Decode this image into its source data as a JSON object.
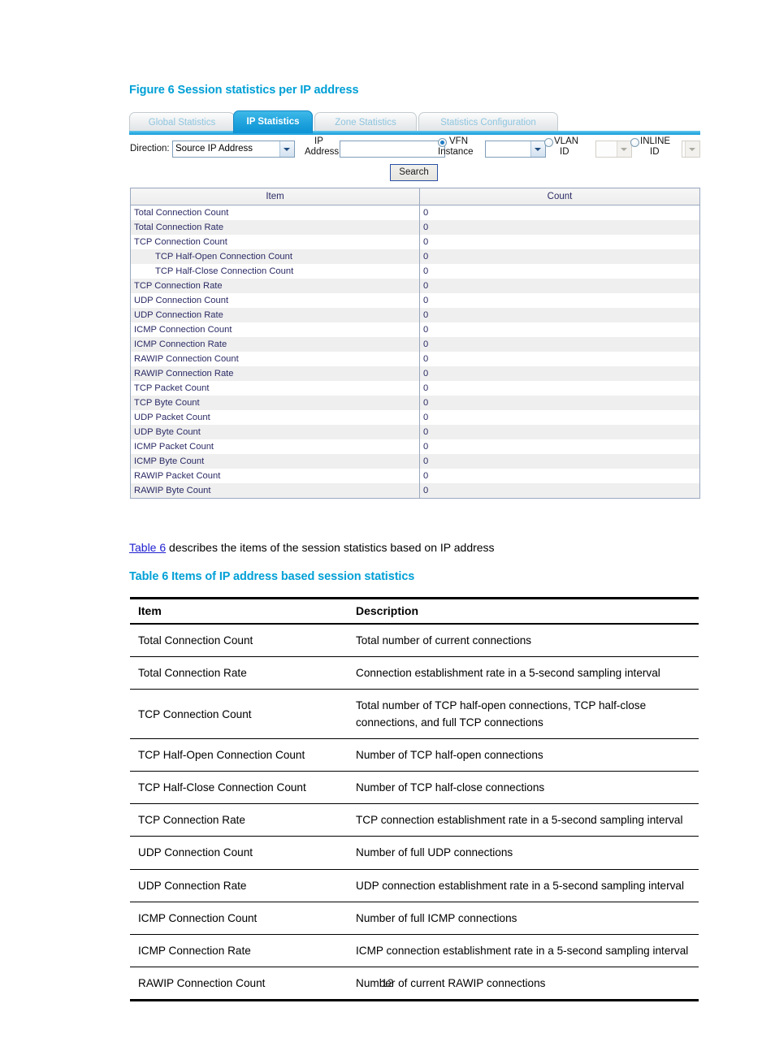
{
  "figure": {
    "caption": "Figure 6 Session statistics per IP address"
  },
  "screenshot": {
    "tabs": [
      {
        "label": "Global Statistics",
        "active": false
      },
      {
        "label": "IP Statistics",
        "active": true
      },
      {
        "label": "Zone Statistics",
        "active": false
      },
      {
        "label": "Statistics Configuration",
        "active": false
      }
    ],
    "form": {
      "direction_label": "Direction:",
      "direction_value": "Source IP Address",
      "ip_address_label_line1": "IP",
      "ip_address_label_line2": "Address:",
      "ip_address_value": "",
      "vfn_label_line1": "VFN",
      "vfn_label_line2": "Instance",
      "vfn_selected": true,
      "vfn_value": "",
      "vlan_label_line1": "VLAN",
      "vlan_label_line2": "ID",
      "vlan_selected": false,
      "vlan_value": "",
      "inline_label_line1": "INLINE",
      "inline_label_line2": "ID",
      "inline_selected": false,
      "inline_value": "",
      "search_label": "Search"
    },
    "stats_table": {
      "headers": [
        "Item",
        "Count"
      ],
      "rows": [
        {
          "item": "Total Connection Count",
          "count": "0",
          "indent": false
        },
        {
          "item": "Total Connection Rate",
          "count": "0",
          "indent": false
        },
        {
          "item": "TCP Connection Count",
          "count": "0",
          "indent": false
        },
        {
          "item": "TCP Half-Open Connection Count",
          "count": "0",
          "indent": true
        },
        {
          "item": "TCP Half-Close Connection Count",
          "count": "0",
          "indent": true
        },
        {
          "item": "TCP Connection Rate",
          "count": "0",
          "indent": false
        },
        {
          "item": "UDP Connection Count",
          "count": "0",
          "indent": false
        },
        {
          "item": "UDP Connection Rate",
          "count": "0",
          "indent": false
        },
        {
          "item": "ICMP Connection Count",
          "count": "0",
          "indent": false
        },
        {
          "item": "ICMP Connection Rate",
          "count": "0",
          "indent": false
        },
        {
          "item": "RAWIP Connection Count",
          "count": "0",
          "indent": false
        },
        {
          "item": "RAWIP Connection Rate",
          "count": "0",
          "indent": false
        },
        {
          "item": "TCP Packet Count",
          "count": "0",
          "indent": false
        },
        {
          "item": "TCP Byte Count",
          "count": "0",
          "indent": false
        },
        {
          "item": "UDP Packet Count",
          "count": "0",
          "indent": false
        },
        {
          "item": "UDP Byte Count",
          "count": "0",
          "indent": false
        },
        {
          "item": "ICMP Packet Count",
          "count": "0",
          "indent": false
        },
        {
          "item": "ICMP Byte Count",
          "count": "0",
          "indent": false
        },
        {
          "item": "RAWIP Packet Count",
          "count": "0",
          "indent": false
        },
        {
          "item": "RAWIP Byte Count",
          "count": "0",
          "indent": false
        }
      ]
    }
  },
  "body": {
    "intro_link": "Table 6",
    "intro_rest": " describes the items of the session statistics based on IP address",
    "table_caption": "Table 6 Items of IP address based session statistics"
  },
  "desc_table": {
    "headers": [
      "Item",
      "Description"
    ],
    "rows": [
      {
        "item": "Total Connection Count",
        "desc": "Total number of current connections"
      },
      {
        "item": "Total Connection Rate",
        "desc": "Connection establishment rate in a 5-second sampling interval"
      },
      {
        "item": "TCP Connection Count",
        "desc": "Total number of TCP half-open connections, TCP half-close connections, and full TCP connections"
      },
      {
        "item": "TCP Half-Open Connection Count",
        "desc": "Number of TCP half-open connections"
      },
      {
        "item": "TCP Half-Close Connection Count",
        "desc": "Number of TCP half-close connections"
      },
      {
        "item": "TCP Connection Rate",
        "desc": "TCP connection establishment rate in a 5-second sampling interval"
      },
      {
        "item": "UDP Connection Count",
        "desc": "Number of full UDP connections"
      },
      {
        "item": "UDP Connection Rate",
        "desc": "UDP connection establishment rate in a 5-second sampling interval"
      },
      {
        "item": "ICMP Connection Count",
        "desc": "Number of full ICMP connections"
      },
      {
        "item": "ICMP Connection Rate",
        "desc": "ICMP connection establishment rate in a 5-second sampling interval"
      },
      {
        "item": "RAWIP Connection Count",
        "desc": "Number of current RAWIP connections"
      }
    ]
  },
  "footer": {
    "page_number": "12"
  },
  "colors": {
    "heading": "#00a0d6",
    "link": "#2020d0",
    "tab_active": "#1ea2dd",
    "table_text": "#2b2b66"
  }
}
